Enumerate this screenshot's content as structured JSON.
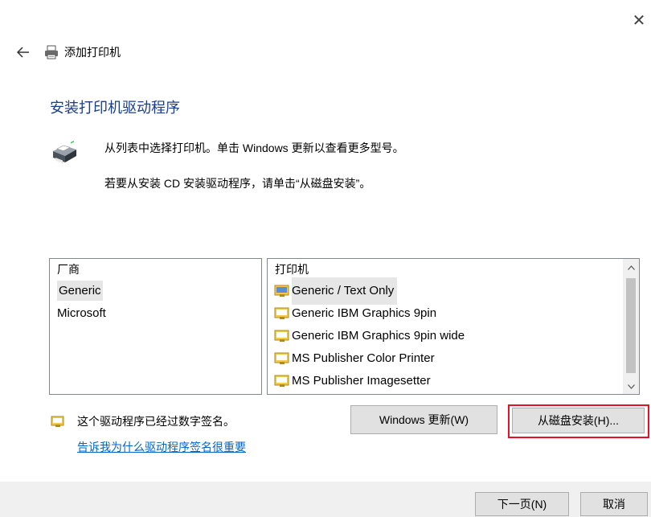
{
  "window": {
    "close_symbol": "✕",
    "title": "添加打印机",
    "back_icon": "back-arrow-icon",
    "title_icon": "printer-icon"
  },
  "heading": "安装打印机驱动程序",
  "instructions": {
    "line1": "从列表中选择打印机。单击 Windows 更新以查看更多型号。",
    "line2": "若要从安装 CD 安装驱动程序，请单击“从磁盘安装”。"
  },
  "manufacturers": {
    "header": "厂商",
    "items": [
      "Generic",
      "Microsoft"
    ],
    "selected": "Generic"
  },
  "printers": {
    "header": "打印机",
    "items": [
      "Generic / Text Only",
      "Generic IBM Graphics 9pin",
      "Generic IBM Graphics 9pin wide",
      "MS Publisher Color Printer",
      "MS Publisher Imagesetter"
    ],
    "selected": "Generic / Text Only"
  },
  "signature": {
    "text": "这个驱动程序已经过数字签名。",
    "link": "告诉我为什么驱动程序签名很重要",
    "icon": "signed-driver-icon"
  },
  "buttons": {
    "windows_update": "Windows 更新(W)",
    "have_disk": "从磁盘安装(H)...",
    "next": "下一页(N)",
    "cancel": "取消"
  },
  "colors": {
    "heading": "#1a3e8c",
    "link": "#0066cc",
    "highlight": "#e81123",
    "selection": "#e6e6e6"
  }
}
